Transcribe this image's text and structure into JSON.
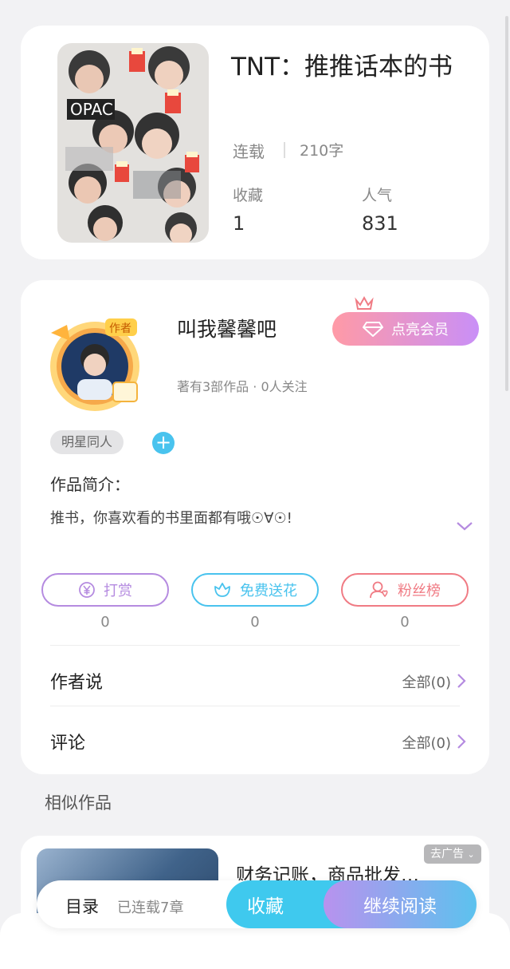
{
  "book": {
    "title": "TNT：推推话本的书",
    "status": "连载",
    "word_count": "210字",
    "stats": [
      {
        "label": "收藏",
        "value": "1"
      },
      {
        "label": "人气",
        "value": "831"
      }
    ]
  },
  "author": {
    "name": "叫我馨馨吧",
    "meta": "著有3部作品 · 0人关注",
    "badge_text": "作者",
    "vip_label": "点亮会员",
    "tag": "明星同人",
    "tag_add": "+",
    "intro_label": "作品简介：",
    "intro_text": "推书，你喜欢看的书里面都有哦☉∀☉!"
  },
  "actions": [
    {
      "label": "打赏",
      "count": "0",
      "color": "#b58be0",
      "icon": "yen-coin-icon"
    },
    {
      "label": "免费送花",
      "count": "0",
      "color": "#49c3ee",
      "icon": "flower-icon"
    },
    {
      "label": "粉丝榜",
      "count": "0",
      "color": "#f07b84",
      "icon": "fan-ranking-icon"
    }
  ],
  "rows": [
    {
      "label": "作者说",
      "value": "全部(0)"
    },
    {
      "label": "评论",
      "value": "全部(0)"
    }
  ],
  "similar_title": "相似作品",
  "ad": {
    "title": "财务记账，商品批发…",
    "badge": "去广告"
  },
  "bottom_bar": {
    "toc_label": "目录",
    "toc_status": "已连载7章",
    "collect_label": "收藏",
    "read_label": "继续阅读"
  },
  "colors": {
    "accent_blue": "#3fc9ee",
    "accent_purple": "#b892ee",
    "vip_pink": "#ff9aa6",
    "arrow_purple": "#b58be0"
  }
}
